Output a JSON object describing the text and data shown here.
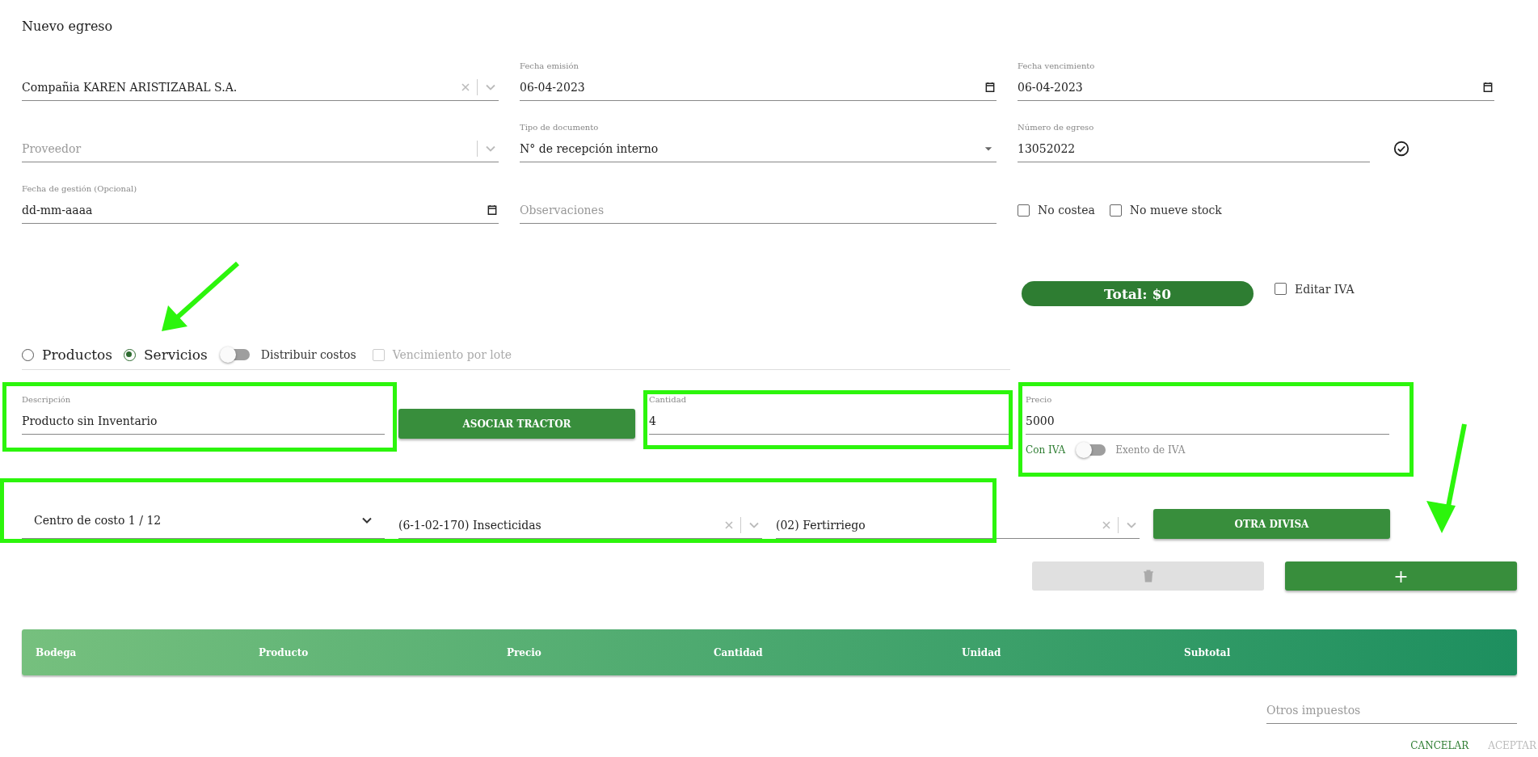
{
  "title": "Nuevo egreso",
  "header_fields": [
    {
      "kind": "select",
      "value": "Compañia KAREN ARISTIZABAL S.A.",
      "clearable": true
    },
    {
      "kind": "date",
      "label": "Fecha emisión",
      "value": "06-04-2023"
    },
    {
      "kind": "date",
      "label": "Fecha vencimiento",
      "value": "06-04-2023"
    },
    {
      "kind": "select",
      "placeholder": "Proveedor",
      "clearable": false
    },
    {
      "kind": "dropdown",
      "label": "Tipo de documento",
      "value": "N° de recepción interno"
    },
    {
      "kind": "text",
      "label": "Número de egreso",
      "value": "13052022",
      "verified": true
    },
    {
      "kind": "date",
      "label": "Fecha de gestión (Opcional)",
      "value": "dd-mm-aaaa"
    },
    {
      "kind": "text",
      "placeholder": "Observaciones"
    },
    {
      "kind": "checks",
      "items": [
        {
          "label": "No costea",
          "checked": false
        },
        {
          "label": "No mueve stock",
          "checked": false
        }
      ]
    }
  ],
  "total": "Total: $0",
  "edit_iva": {
    "label": "Editar IVA",
    "checked": false
  },
  "item_type": [
    {
      "label": "Productos",
      "selected": false
    },
    {
      "label": "Servicios",
      "selected": true
    }
  ],
  "distribute_costs": {
    "label": "Distribuir costos",
    "on": false
  },
  "lot_expiry": {
    "label": "Vencimiento por lote",
    "checked": false,
    "disabled": true
  },
  "description": {
    "label": "Descripción",
    "value": "Producto sin Inventario"
  },
  "associate_button": "ASOCIAR TRACTOR",
  "quantity": {
    "label": "Cantidad",
    "value": "4"
  },
  "price": {
    "label": "Precio",
    "value": "5000",
    "iva_label": "Con IVA",
    "exempt_label": "Exento de IVA",
    "exempt": false
  },
  "cost_center": "Centro de costo 1 / 12",
  "accounts": [
    {
      "value": "(6-1-02-170) Insecticidas",
      "clearable": true
    },
    {
      "value": "(02) Fertirriego",
      "clearable": true
    }
  ],
  "other_currency_button": "OTRA DIVISA",
  "delete_button": {
    "disabled": true
  },
  "add_button": "+",
  "table": {
    "columns": [
      "Bodega",
      "Producto",
      "Precio",
      "Cantidad",
      "Unidad",
      "Subtotal"
    ]
  },
  "other_taxes": {
    "placeholder": "Otros impuestos"
  },
  "actions": [
    {
      "label": "CANCELAR",
      "disabled": false
    },
    {
      "label": "ACEPTAR",
      "disabled": true
    }
  ]
}
